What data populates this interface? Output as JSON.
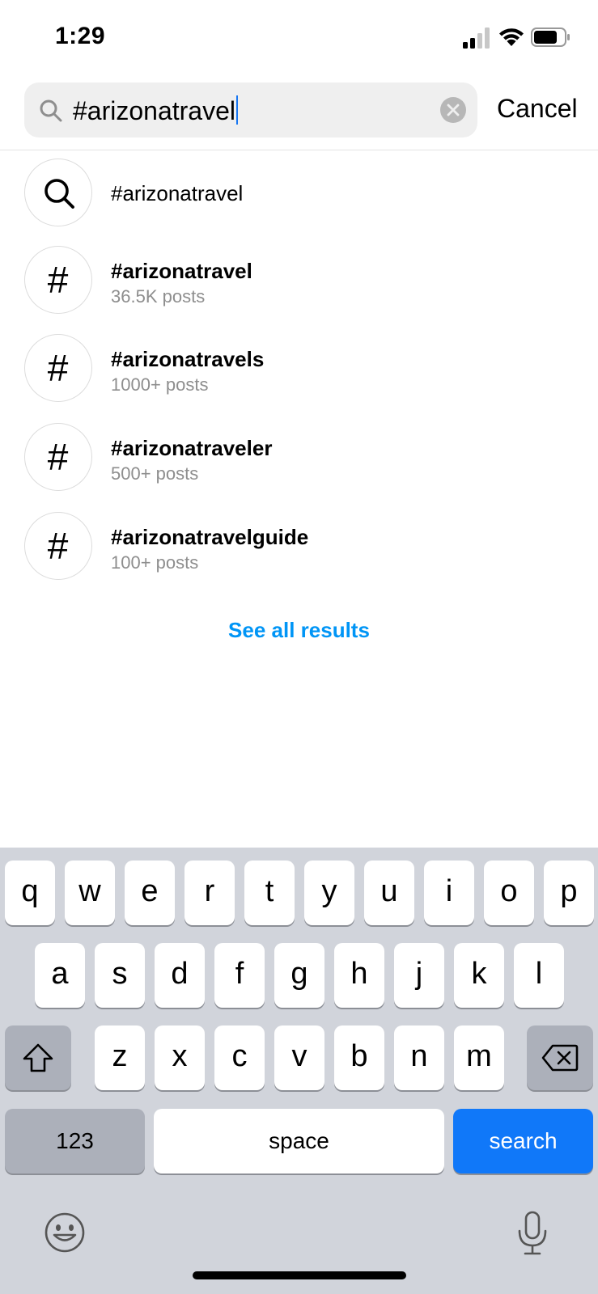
{
  "status_bar": {
    "time": "1:29",
    "icons": [
      "cellular-signal-icon",
      "wifi-icon",
      "battery-icon"
    ]
  },
  "search": {
    "query": "#arizonatravel",
    "cancel_label": "Cancel",
    "icons": [
      "search-icon",
      "clear-icon"
    ]
  },
  "results": [
    {
      "icon": "search-icon",
      "title": "#arizonatravel",
      "subtitle": ""
    },
    {
      "icon": "hashtag-icon",
      "title": "#arizonatravel",
      "subtitle": "36.5K posts"
    },
    {
      "icon": "hashtag-icon",
      "title": "#arizonatravels",
      "subtitle": "1000+ posts"
    },
    {
      "icon": "hashtag-icon",
      "title": "#arizonatraveler",
      "subtitle": "500+ posts"
    },
    {
      "icon": "hashtag-icon",
      "title": "#arizonatravelguide",
      "subtitle": "100+ posts"
    }
  ],
  "hash_symbol": "#",
  "see_all_label": "See all results",
  "keyboard": {
    "row1": [
      "q",
      "w",
      "e",
      "r",
      "t",
      "y",
      "u",
      "i",
      "o",
      "p"
    ],
    "row2": [
      "a",
      "s",
      "d",
      "f",
      "g",
      "h",
      "j",
      "k",
      "l"
    ],
    "row3": [
      "z",
      "x",
      "c",
      "v",
      "b",
      "n",
      "m"
    ],
    "numbers_label": "123",
    "space_label": "space",
    "search_label": "search",
    "icons": [
      "shift-icon",
      "backspace-icon",
      "emoji-icon",
      "microphone-icon"
    ]
  },
  "colors": {
    "link_blue": "#0095f6",
    "search_key_blue": "#1078f9",
    "keyboard_bg": "#d1d4db"
  }
}
